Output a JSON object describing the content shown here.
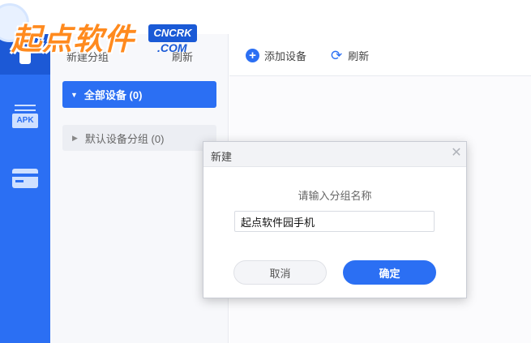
{
  "watermark": {
    "brand": "起点软件",
    "cncrk": "CNCRK",
    "com": ".COM"
  },
  "rail": {
    "items": [
      {
        "icon": "phone-icon",
        "active": true
      },
      {
        "icon": "apk-icon",
        "label": "APK"
      },
      {
        "icon": "card-icon"
      }
    ]
  },
  "panel": {
    "toolbar": {
      "new_group_label": "新建分组",
      "refresh_label": "刷新"
    },
    "groups": [
      {
        "label": "全部设备 (0)",
        "selected": true
      },
      {
        "label": "默认设备分组 (0)",
        "selected": false
      }
    ]
  },
  "main": {
    "toolbar": {
      "add_device_label": "添加设备",
      "refresh_label": "刷新"
    }
  },
  "modal": {
    "title": "新建",
    "prompt": "请输入分组名称",
    "input_value": "起点软件园手机",
    "cancel_label": "取消",
    "confirm_label": "确定"
  },
  "colors": {
    "accent": "#2b6ff3",
    "rail": "#2b6ff3",
    "brand_orange": "#ff8a1e"
  }
}
